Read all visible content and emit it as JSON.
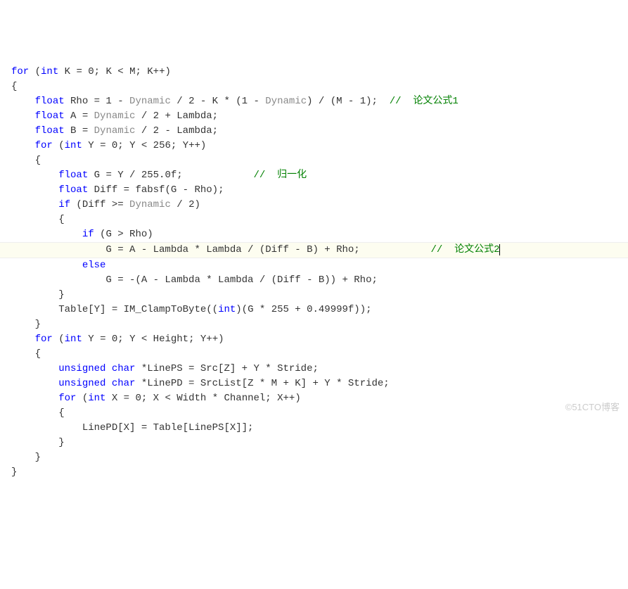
{
  "code": {
    "l01_for": "for",
    "l01_int": "int",
    "l01_rest": " K = 0; K < M; K++)",
    "l03_float": "float",
    "l03_var": " Rho = 1 - ",
    "l03_dyn": "Dynamic",
    "l03_mid": " / 2 - K * (1 - ",
    "l03_dyn2": "Dynamic",
    "l03_end": ") / (M - 1);  ",
    "l03_cm": "//  论文公式1",
    "l04_float": "float",
    "l04_a": " A = ",
    "l04_dyn": "Dynamic",
    "l04_rest": " / 2 + Lambda;",
    "l05_float": "float",
    "l05_b": " B = ",
    "l05_dyn": "Dynamic",
    "l05_rest": " / 2 - Lambda;",
    "l06_for": "for",
    "l06_int": "int",
    "l06_rest": " Y = 0; Y < 256; Y++)",
    "l08_float": "float",
    "l08_g": " G = Y / 255.0f;            ",
    "l08_cm": "//  归一化",
    "l09_float": "float",
    "l09_diff": " Diff = fabsf(G - Rho);",
    "l10_if": "if",
    "l10_cond": " (Diff >= ",
    "l10_dyn": "Dynamic",
    "l10_rest": " / 2)",
    "l12_if": "if",
    "l12_cond": " (G > Rho)",
    "l13_body": "                G = A - Lambda * Lambda / (Diff - B) + Rho;            ",
    "l13_cm": "//  论文公式2",
    "l14_else": "else",
    "l15_body": "                G = -(A - Lambda * Lambda / (Diff - B)) + Rho;",
    "l17_table": "        Table[Y] = IM_ClampToByte((",
    "l17_int": "int",
    "l17_rest": ")(G * 255 + 0.49999f));",
    "l19_for": "for",
    "l19_int": "int",
    "l19_rest": " Y = 0; Y < Height; Y++)",
    "l21_uc": "unsigned char",
    "l21_lineps": " *LinePS = Src[Z] + Y * Stride;",
    "l22_uc": "unsigned char",
    "l22_linepd": " *LinePD = SrcList[Z * M + K] + Y * Stride;",
    "l23_for": "for",
    "l23_int": "int",
    "l23_rest": " X = 0; X < Width * Channel; X++)",
    "l25_body": "            LinePD[X] = Table[LinePS[X]];"
  },
  "watermark": "©51CTO博客"
}
